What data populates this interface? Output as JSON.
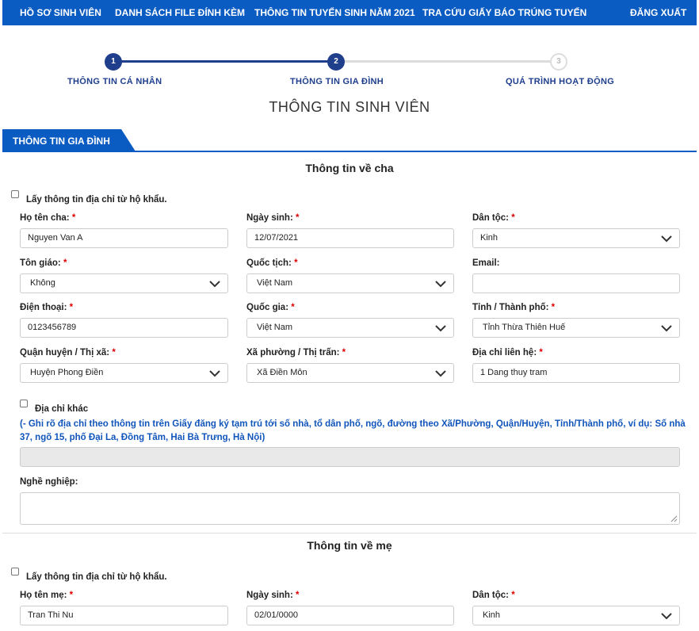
{
  "nav": {
    "items": [
      "HỒ SƠ SINH VIÊN",
      "DANH SÁCH FILE ĐÍNH KÈM",
      "THÔNG TIN TUYỂN SINH NĂM 2021",
      "TRA CỨU GIẤY BÁO TRÚNG TUYỂN"
    ],
    "logout": "ĐĂNG XUẤT",
    "color": "#0a5cc2"
  },
  "stepper": {
    "steps": [
      {
        "number": "1",
        "label": "THÔNG TIN CÁ NHÂN",
        "state": "done"
      },
      {
        "number": "2",
        "label": "THÔNG TIN GIA ĐÌNH",
        "state": "current"
      },
      {
        "number": "3",
        "label": "QUÁ TRÌNH HOẠT ĐỘNG",
        "state": "pending"
      }
    ]
  },
  "page_title": "THÔNG TIN SINH VIÊN",
  "section_tab": "THÔNG TIN GIA ĐÌNH",
  "father": {
    "heading": "Thông tin về cha",
    "copy_address_label": "Lấy thông tin địa chỉ từ hộ khẩu.",
    "fields": {
      "name": {
        "label": "Họ tên cha:",
        "value": "Nguyen Van A"
      },
      "dob": {
        "label": "Ngày sinh:",
        "value": "12/07/2021"
      },
      "ethnicity": {
        "label": "Dân tộc:",
        "value": "Kinh"
      },
      "religion": {
        "label": "Tôn giáo:",
        "value": "Không"
      },
      "nationality": {
        "label": "Quốc tịch:",
        "value": "Việt Nam"
      },
      "email": {
        "label": "Email:",
        "value": ""
      },
      "phone": {
        "label": "Điện thoại:",
        "value": "0123456789"
      },
      "country": {
        "label": "Quốc gia:",
        "value": "Việt Nam"
      },
      "province": {
        "label": "Tỉnh / Thành phố:",
        "value": "Tỉnh Thừa Thiên Huế"
      },
      "district": {
        "label": "Quận huyện / Thị xã:",
        "value": "Huyện Phong Điền"
      },
      "ward": {
        "label": "Xã phường / Thị trấn:",
        "value": "Xã Điền Môn"
      },
      "address": {
        "label": "Địa chỉ liên hệ:",
        "value": "1 Dang thuy tram"
      }
    },
    "other_address_label": "Địa chỉ khác",
    "other_address_note": "(- Ghi rõ địa chỉ theo thông tin trên Giấy đăng ký tạm trú tới số nhà, tổ dân phố, ngõ, đường theo Xã/Phường, Quận/Huyện, Tỉnh/Thành phố, ví dụ: Số nhà 37, ngõ 15, phố Đại La, Đồng Tâm, Hai Bà Trưng, Hà Nội)",
    "other_address_value": "",
    "occupation_label": "Nghề nghiệp:",
    "occupation_value": ""
  },
  "mother": {
    "heading": "Thông tin về mẹ",
    "copy_address_label": "Lấy thông tin địa chỉ từ hộ khẩu.",
    "fields": {
      "name": {
        "label": "Họ tên mẹ:",
        "value": "Tran Thi Nu"
      },
      "dob": {
        "label": "Ngày sinh:",
        "value": "02/01/0000"
      },
      "ethnicity": {
        "label": "Dân tộc:",
        "value": "Kinh"
      }
    }
  },
  "required_mark": "*"
}
